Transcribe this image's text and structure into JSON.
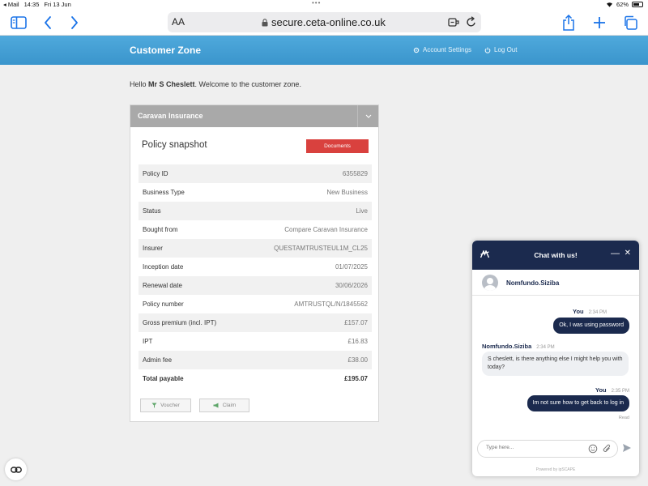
{
  "statusbar": {
    "app": "◂ Mail",
    "time": "14:35",
    "date": "Fri 13 Jun",
    "dots": "•••",
    "battery": "62%"
  },
  "browser": {
    "aa": "AA",
    "url": "secure.ceta-online.co.uk"
  },
  "site": {
    "brand": "Customer Zone",
    "account_settings": "Account Settings",
    "logout": "Log Out"
  },
  "greeting": {
    "prefix": "Hello",
    "name": "Mr S Cheslett",
    "suffix": ". Welcome to the customer zone."
  },
  "card": {
    "title": "Caravan Insurance",
    "snapshot_title": "Policy snapshot",
    "documents_label": "Documents",
    "rows": [
      {
        "label": "Policy ID",
        "value": "6355829"
      },
      {
        "label": "Business Type",
        "value": "New Business"
      },
      {
        "label": "Status",
        "value": "Live"
      },
      {
        "label": "Bought from",
        "value": "Compare Caravan Insurance"
      },
      {
        "label": "Insurer",
        "value": "QUESTAMTRUSTEUL1M_CL25"
      },
      {
        "label": "Inception date",
        "value": "01/07/2025"
      },
      {
        "label": "Renewal date",
        "value": "30/06/2026"
      },
      {
        "label": "Policy number",
        "value": "AMTRUSTQL/N/1845562"
      },
      {
        "label": "Gross premium (incl. IPT)",
        "value": "£157.07"
      },
      {
        "label": "IPT",
        "value": "£16.83"
      },
      {
        "label": "Admin fee",
        "value": "£38.00"
      },
      {
        "label": "Total payable",
        "value": "£195.07"
      }
    ],
    "voucher_label": "Voucher",
    "claim_label": "Claim"
  },
  "chat": {
    "title": "Chat with us!",
    "agent": "Nomfundo.Siziba",
    "messages": [
      {
        "sender": "You",
        "time": "2:34 PM",
        "text": "Ok, I was using password"
      },
      {
        "sender": "Nomfundo.Siziba",
        "time": "2:34 PM",
        "text": "S cheslett, is there anything else I might help you with today?"
      },
      {
        "sender": "You",
        "time": "2:35 PM",
        "text": "Im not sure how to get back to log in"
      }
    ],
    "read": "Read",
    "placeholder": "Type here...",
    "powered": "Powered by ipSCAPE"
  }
}
